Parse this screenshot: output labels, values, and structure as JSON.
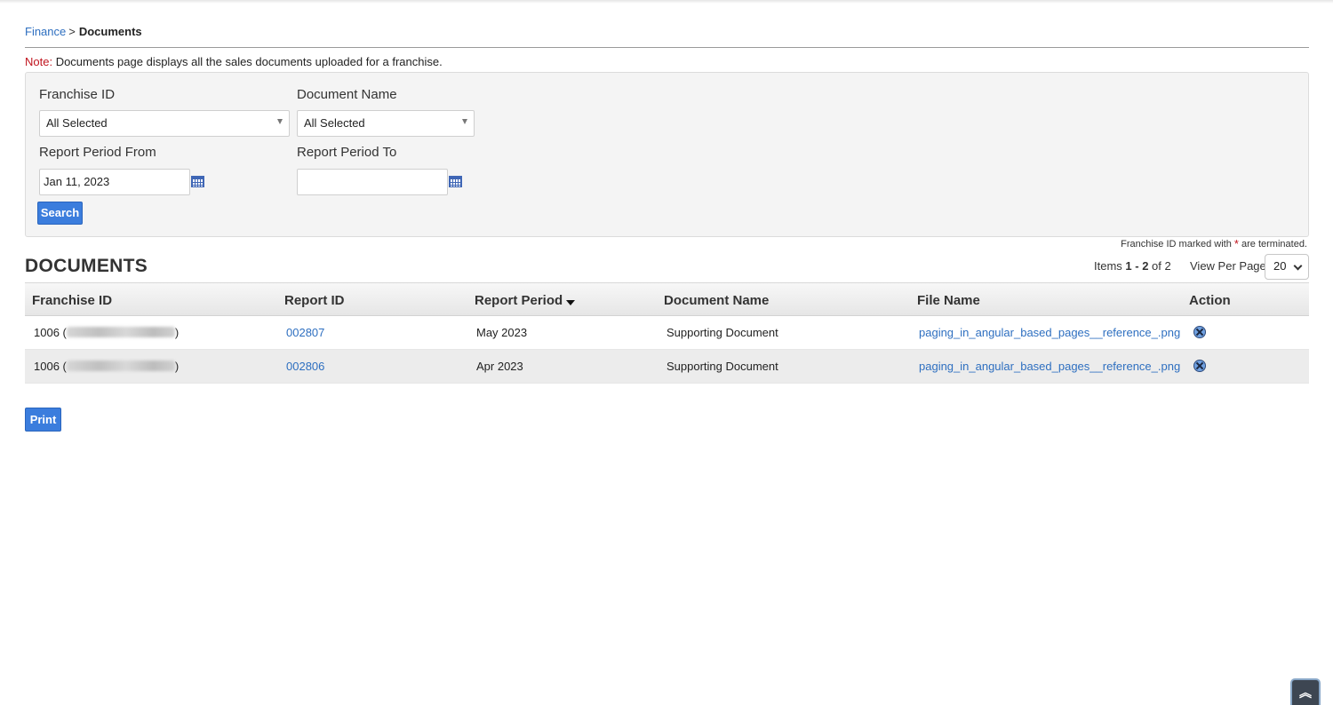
{
  "breadcrumb": {
    "parent": "Finance",
    "separator": ">",
    "current": "Documents"
  },
  "note": {
    "label": "Note:",
    "text": " Documents page displays all the sales documents uploaded for a franchise."
  },
  "filters": {
    "franchise_id_label": "Franchise ID",
    "franchise_id_value": "All Selected",
    "document_name_label": "Document Name",
    "document_name_value": "All Selected",
    "period_from_label": "Report Period From",
    "period_from_value": "Jan 11, 2023",
    "period_to_label": "Report Period To",
    "period_to_value": "",
    "search_label": "Search"
  },
  "terminated_note": {
    "prefix": "Franchise ID marked with ",
    "star": "*",
    "suffix": " are terminated."
  },
  "documents": {
    "title": "DOCUMENTS",
    "items_prefix": "Items ",
    "items_range": "1 - 2",
    "items_of": " of 2",
    "view_per_page_label": "View Per Page",
    "view_per_page_value": "20",
    "columns": [
      "Franchise ID",
      "Report ID",
      "Report Period",
      "Document Name",
      "File Name",
      "Action"
    ],
    "sorted_column": "Report Period",
    "rows": [
      {
        "franchise_id": "1006 (",
        "franchise_close": ")",
        "report_id": "002807",
        "report_period": "May 2023",
        "document_name": "Supporting Document",
        "file_name": "paging_in_angular_based_pages__reference_.png"
      },
      {
        "franchise_id": "1006 (",
        "franchise_close": ")",
        "report_id": "002806",
        "report_period": "Apr 2023",
        "document_name": "Supporting Document",
        "file_name": "paging_in_angular_based_pages__reference_.png"
      }
    ]
  },
  "print_label": "Print",
  "scroll_top_glyph": "︽",
  "colors": {
    "link": "#2e6fc0",
    "button": "#3b7ddd",
    "note_label": "#c0141e"
  }
}
